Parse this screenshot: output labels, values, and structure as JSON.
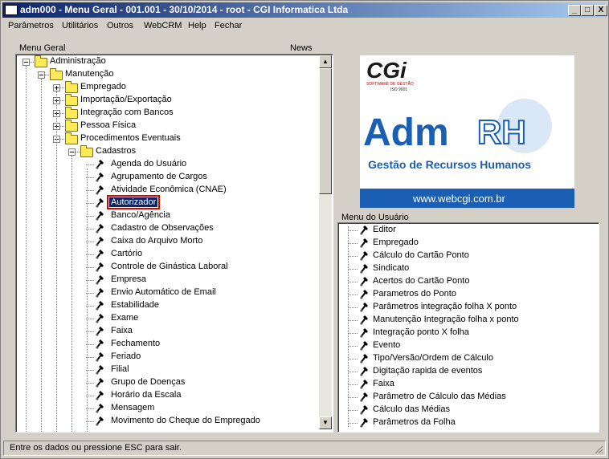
{
  "window": {
    "title": "adm000 - Menu Geral - 001.001 - 30/10/2014 - root - CGI Informatica Ltda",
    "minimize": "_",
    "maximize": "□",
    "close": "X"
  },
  "menubar": [
    {
      "label": "Parâmetros"
    },
    {
      "label": "Utilitários"
    },
    {
      "label": "Outros"
    },
    {
      "label": "WebCRM"
    },
    {
      "label": "Help"
    },
    {
      "label": "Fechar"
    }
  ],
  "panels": {
    "menu_geral": "Menu Geral",
    "news": "News",
    "menu_usuario": "Menu do Usuário"
  },
  "tree": [
    {
      "label": "Administração",
      "type": "folder",
      "expanded": true
    },
    {
      "label": "Manutenção",
      "type": "folder",
      "expanded": true
    },
    {
      "label": "Empregado",
      "type": "folder",
      "expanded": false
    },
    {
      "label": "Importação/Exportação",
      "type": "folder",
      "expanded": false
    },
    {
      "label": "Integração com Bancos",
      "type": "folder",
      "expanded": false
    },
    {
      "label": "Pessoa Física",
      "type": "folder",
      "expanded": false
    },
    {
      "label": "Procedimentos Eventuais",
      "type": "folder",
      "expanded": true
    },
    {
      "label": "Cadastros",
      "type": "folder",
      "expanded": true
    },
    {
      "label": "Agenda do Usuário",
      "type": "leaf"
    },
    {
      "label": "Agrupamento de Cargos",
      "type": "leaf"
    },
    {
      "label": "Atividade Econômica (CNAE)",
      "type": "leaf"
    },
    {
      "label": "Autorizador",
      "type": "leaf",
      "selected": true
    },
    {
      "label": "Banco/Agência",
      "type": "leaf"
    },
    {
      "label": "Cadastro de Observações",
      "type": "leaf"
    },
    {
      "label": "Caixa do Arquivo Morto",
      "type": "leaf"
    },
    {
      "label": "Cartório",
      "type": "leaf"
    },
    {
      "label": "Controle de Ginástica Laboral",
      "type": "leaf"
    },
    {
      "label": "Empresa",
      "type": "leaf"
    },
    {
      "label": "Envio Automático de Email",
      "type": "leaf"
    },
    {
      "label": "Estabilidade",
      "type": "leaf"
    },
    {
      "label": "Exame",
      "type": "leaf"
    },
    {
      "label": "Faixa",
      "type": "leaf"
    },
    {
      "label": "Fechamento",
      "type": "leaf"
    },
    {
      "label": "Feriado",
      "type": "leaf"
    },
    {
      "label": "Filial",
      "type": "leaf"
    },
    {
      "label": "Grupo de Doenças",
      "type": "leaf"
    },
    {
      "label": "Horário da Escala",
      "type": "leaf"
    },
    {
      "label": "Mensagem",
      "type": "leaf"
    },
    {
      "label": "Movimento do Cheque do Empregado",
      "type": "leaf"
    }
  ],
  "user_menu": [
    {
      "label": "Editor"
    },
    {
      "label": "Empregado"
    },
    {
      "label": "Cálculo do Cartão Ponto"
    },
    {
      "label": "Sindicato"
    },
    {
      "label": "Acertos do Cartão Ponto"
    },
    {
      "label": "Parametros do Ponto"
    },
    {
      "label": "Parâmetros integração folha X ponto"
    },
    {
      "label": "Manutenção Integração folha x ponto"
    },
    {
      "label": "Integração ponto X folha"
    },
    {
      "label": "Evento"
    },
    {
      "label": "Tipo/Versão/Ordem de Cálculo"
    },
    {
      "label": "Digitação rapida de eventos"
    },
    {
      "label": "Faixa"
    },
    {
      "label": "Parâmetro de Cálculo das Médias"
    },
    {
      "label": "Cálculo das Médias"
    },
    {
      "label": "Parâmetros da Folha"
    }
  ],
  "logo": {
    "cgi": "CGi",
    "cgi_sub1": "SOFTWARE DE GESTÃO",
    "cgi_sub2": "ISO 9001",
    "adm": "Adm",
    "rh": "RH",
    "subtitle": "Gestão de Recursos Humanos",
    "url": "www.webcgi.com.br"
  },
  "status": "Entre os dados ou pressione ESC para sair.",
  "colors": {
    "title_start": "#0a246a",
    "title_end": "#a6caf0",
    "brand_blue": "#1a5fb4",
    "selection": "#0a246a"
  }
}
